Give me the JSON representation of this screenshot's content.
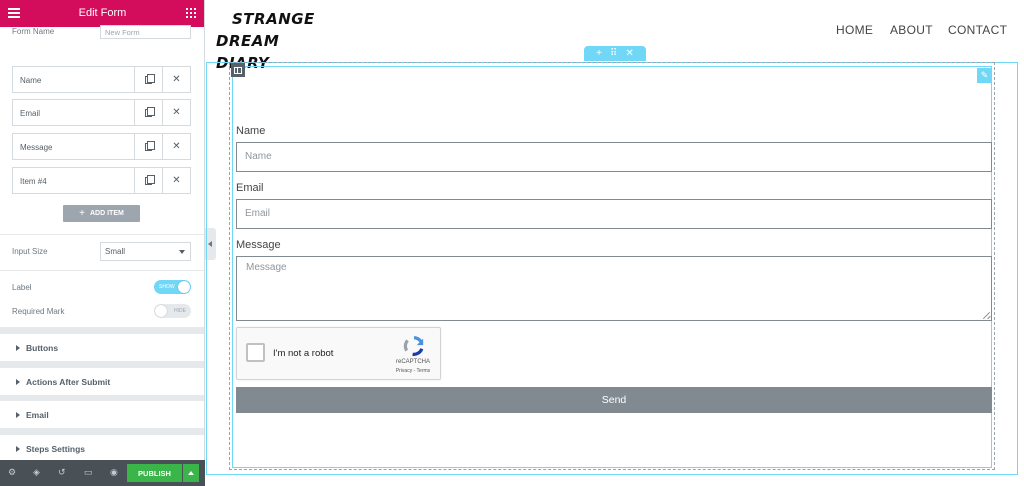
{
  "panel": {
    "title": "Edit Form",
    "form_name": {
      "label": "Form Name",
      "placeholder": "New Form"
    },
    "fields": [
      {
        "name": "Name"
      },
      {
        "name": "Email"
      },
      {
        "name": "Message"
      },
      {
        "name": "Item #4"
      }
    ],
    "add_item_label": "ADD ITEM",
    "input_size": {
      "label": "Input Size",
      "value": "Small"
    },
    "label_toggle": {
      "label": "Label",
      "state": "SHOW",
      "on": true
    },
    "required_toggle": {
      "label": "Required Mark",
      "state": "HIDE",
      "on": false
    },
    "sections": [
      "Buttons",
      "Actions After Submit",
      "Email",
      "Steps Settings"
    ],
    "footer": {
      "icons": [
        "gear-icon",
        "layers-icon",
        "history-icon",
        "monitor-icon",
        "eye-icon"
      ],
      "publish_label": "PUBLISH"
    }
  },
  "site": {
    "logo_line1": "STRANGE",
    "logo_line2": "DREAM DIARY",
    "nav": [
      "HOME",
      "ABOUT",
      "CONTACT"
    ]
  },
  "form": {
    "name": {
      "label": "Name",
      "placeholder": "Name"
    },
    "email": {
      "label": "Email",
      "placeholder": "Email"
    },
    "message": {
      "label": "Message",
      "placeholder": "Message"
    },
    "recaptcha": {
      "text": "I'm not a robot",
      "brand": "reCAPTCHA",
      "terms": "Privacy - Terms"
    },
    "send_label": "Send"
  },
  "colors": {
    "header": "#d30c5c",
    "accent": "#71d7f7",
    "publish": "#39b54a",
    "button": "#818a91"
  }
}
